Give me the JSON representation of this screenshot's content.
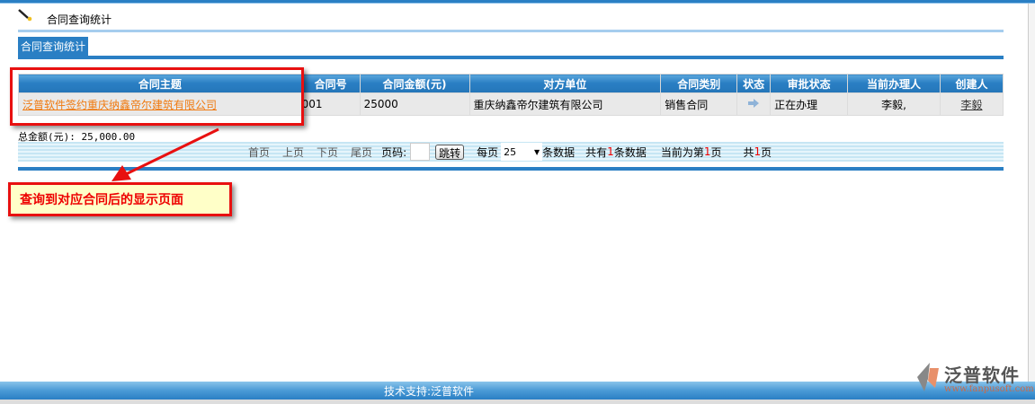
{
  "header": {
    "title": "合同查询统计",
    "tab_label": "合同查询统计"
  },
  "table": {
    "columns": [
      "合同主题",
      "合同号",
      "合同金额(元)",
      "对方单位",
      "合同类别",
      "状态",
      "审批状态",
      "当前办理人",
      "创建人"
    ],
    "rows": [
      {
        "subject": "泛普软件签约重庆纳鑫帝尔建筑有限公司",
        "number": "001",
        "amount": "25000",
        "counterparty": "重庆纳鑫帝尔建筑有限公司",
        "category": "销售合同",
        "status_icon": "arrow-right-icon",
        "approval_status": "正在办理",
        "current_handler": "李毅,",
        "creator": "李毅"
      }
    ]
  },
  "summary": {
    "total": "总金额(元): 25,000.00"
  },
  "pager": {
    "first": "首页",
    "prev": "上页",
    "next": "下页",
    "last": "尾页",
    "page_label": "页码:",
    "page_value": "",
    "jump": "跳转",
    "per_page_prefix": "每页",
    "per_page_value": "25",
    "per_page_suffix": "条数据",
    "total_prefix": "共有",
    "total_count": "1",
    "total_suffix": "条数据",
    "current_prefix": "当前为第",
    "current_page": "1",
    "current_suffix": "页",
    "pages_prefix": "共",
    "pages_count": "1",
    "pages_suffix": "页"
  },
  "annotation": {
    "text": "查询到对应合同后的显示页面",
    "color": "#e81010"
  },
  "footer": {
    "text": "技术支持:泛普软件",
    "logo_text": "泛普软件",
    "logo_url": "www.fanpusoft.com"
  },
  "colors": {
    "primary": "#2a7fc4",
    "link": "#f07a10",
    "highlight": "#e00000"
  }
}
